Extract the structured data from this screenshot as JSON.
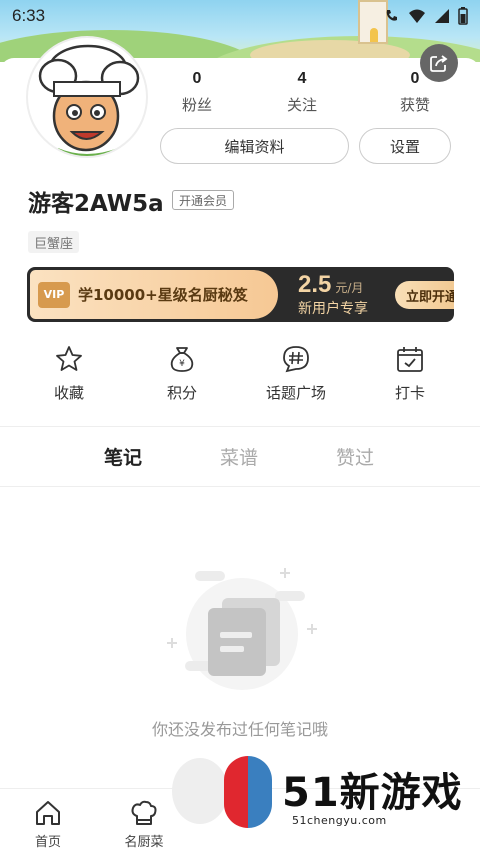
{
  "status_bar": {
    "time": "6:33"
  },
  "profile": {
    "username": "游客2AW5a",
    "member_badge": "开通会员",
    "zodiac": "巨蟹座",
    "stats": [
      {
        "num": "0",
        "label": "粉丝"
      },
      {
        "num": "4",
        "label": "关注"
      },
      {
        "num": "0",
        "label": "获赞"
      }
    ],
    "edit_button": "编辑资料",
    "settings_button": "设置"
  },
  "vip_banner": {
    "tag": "VIP",
    "text": "学10000+星级名厨秘笈",
    "price": "2.5",
    "price_unit": "元/月",
    "price_sub": "新用户专享",
    "cta": "立即开通"
  },
  "shortcuts": [
    {
      "icon": "star-icon",
      "label": "收藏"
    },
    {
      "icon": "money-bag-icon",
      "label": "积分"
    },
    {
      "icon": "hashtag-chat-icon",
      "label": "话题广场"
    },
    {
      "icon": "calendar-check-icon",
      "label": "打卡"
    }
  ],
  "tabs": [
    {
      "label": "笔记",
      "active": true
    },
    {
      "label": "菜谱",
      "active": false
    },
    {
      "label": "赞过",
      "active": false
    }
  ],
  "empty_state": {
    "text": "你还没发布过任何笔记哦"
  },
  "bottom_nav": [
    {
      "icon": "home-icon",
      "label": "首页"
    },
    {
      "icon": "chef-hat-icon",
      "label": "名厨菜"
    }
  ],
  "watermark": {
    "brand": "51新游戏",
    "url": "51chengyu.com"
  },
  "colors": {
    "vip_dark": "#2b2b2b",
    "vip_gold": "#f3d4a4",
    "sky": "#8fd3f0",
    "grass": "#9fd27a"
  }
}
